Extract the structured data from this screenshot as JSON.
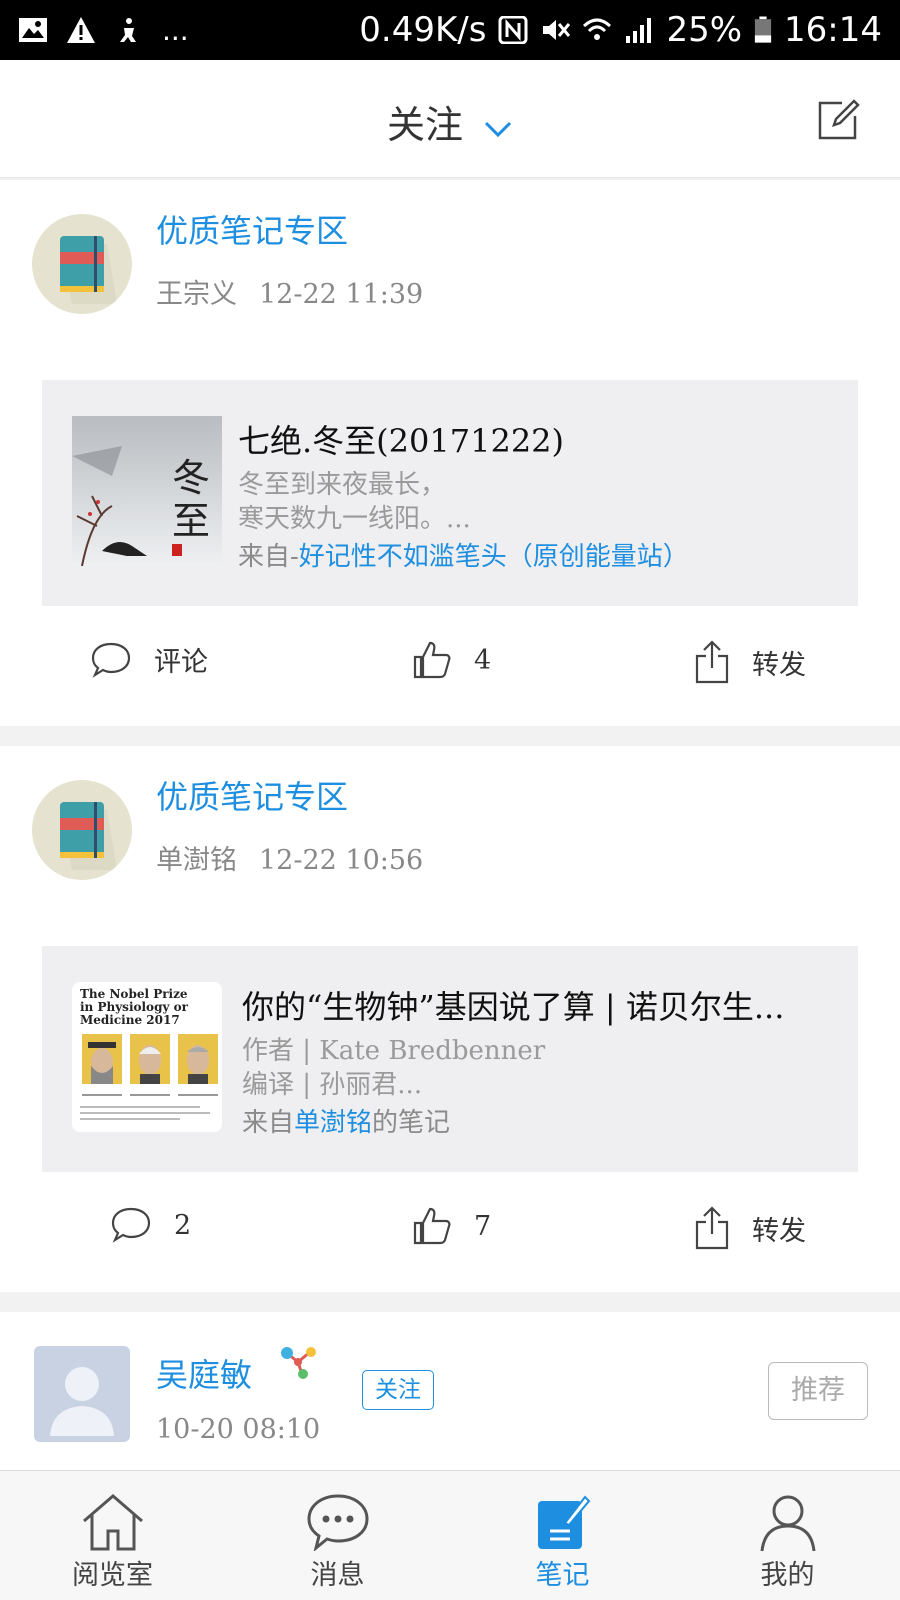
{
  "status_bar": {
    "left_more": "...",
    "net_speed": "0.49K/s",
    "battery": "25%",
    "time": "16:14"
  },
  "header": {
    "title": "关注",
    "icons": [
      "chevron-down-icon",
      "compose-icon"
    ]
  },
  "feed": [
    {
      "group": "优质笔记专区",
      "author": "王宗义",
      "time": "12-22 11:39",
      "title": "七绝.冬至(20171222)",
      "lines": [
        "冬至到来夜最长，",
        "寒天数九一线阳。..."
      ],
      "source_prefix": "来自-",
      "source_link": "好记性不如滥笔头（原创能量站）",
      "source_suffix": "",
      "comment": "评论",
      "likes": "4",
      "share": "转发"
    },
    {
      "group": "优质笔记专区",
      "author": "单澍铭",
      "time": "12-22 10:56",
      "title": "你的“生物钟”基因说了算 | 诺贝尔生...",
      "lines": [
        "作者 | Kate Bredbenner",
        "编译 | 孙丽君..."
      ],
      "source_prefix": "来自",
      "source_link": "单澍铭",
      "source_suffix": "的笔记",
      "comment": "2",
      "likes": "7",
      "share": "转发",
      "thumb_text": {
        "heading": "The Nobel Prize in Physiology or Medicine 2017"
      }
    }
  ],
  "user_card": {
    "name": "吴庭敏",
    "follow": "关注",
    "time": "10-20 08:10",
    "recommend": "推荐"
  },
  "tabs": [
    {
      "label": "阅览室",
      "icon": "home-icon"
    },
    {
      "label": "消息",
      "icon": "chat-icon"
    },
    {
      "label": "笔记",
      "icon": "note-icon",
      "active": true
    },
    {
      "label": "我的",
      "icon": "user-icon"
    }
  ],
  "colors": {
    "accent": "#1e8fe0",
    "background": "#f2f2f2"
  }
}
